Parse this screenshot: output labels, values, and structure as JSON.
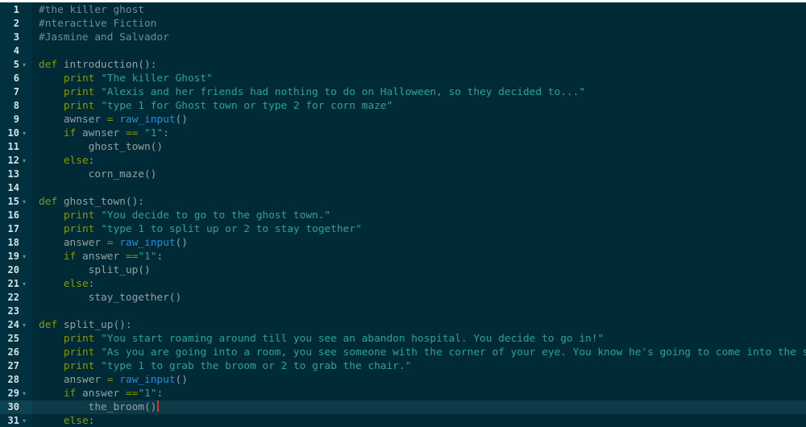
{
  "colors": {
    "background": "#002b36",
    "gutter": "#01313f",
    "active_line": "#0d3a47",
    "comment": "#6f8c95",
    "keyword": "#859900",
    "string": "#2aa198",
    "builtin": "#268bd2",
    "plain": "#93a1a1",
    "line_number": "#d7e2e2",
    "cursor": "#dc322f"
  },
  "editor": {
    "active_line": 30,
    "cursor_after": "()",
    "lines": [
      {
        "n": 1,
        "fold": false,
        "tokens": [
          {
            "t": "#the killer ghost",
            "k": "comment"
          }
        ]
      },
      {
        "n": 2,
        "fold": false,
        "tokens": [
          {
            "t": "#nteractive Fiction",
            "k": "comment"
          }
        ]
      },
      {
        "n": 3,
        "fold": false,
        "tokens": [
          {
            "t": "#Jasmine and Salvador",
            "k": "comment"
          }
        ]
      },
      {
        "n": 4,
        "fold": false,
        "tokens": []
      },
      {
        "n": 5,
        "fold": true,
        "tokens": [
          {
            "t": "def",
            "k": "keyword"
          },
          {
            "t": " introduction():",
            "k": "plain"
          }
        ]
      },
      {
        "n": 6,
        "fold": false,
        "tokens": [
          {
            "t": "    ",
            "k": "plain"
          },
          {
            "t": "print",
            "k": "keyword"
          },
          {
            "t": " ",
            "k": "plain"
          },
          {
            "t": "\"The killer Ghost\"",
            "k": "string"
          }
        ]
      },
      {
        "n": 7,
        "fold": false,
        "tokens": [
          {
            "t": "    ",
            "k": "plain"
          },
          {
            "t": "print",
            "k": "keyword"
          },
          {
            "t": " ",
            "k": "plain"
          },
          {
            "t": "\"Alexis and her friends had nothing to do on Halloween, so they decided to...\"",
            "k": "string"
          }
        ]
      },
      {
        "n": 8,
        "fold": false,
        "tokens": [
          {
            "t": "    ",
            "k": "plain"
          },
          {
            "t": "print",
            "k": "keyword"
          },
          {
            "t": " ",
            "k": "plain"
          },
          {
            "t": "\"type 1 for Ghost town or type 2 for corn maze\"",
            "k": "string"
          }
        ]
      },
      {
        "n": 9,
        "fold": false,
        "tokens": [
          {
            "t": "    awnser ",
            "k": "plain"
          },
          {
            "t": "=",
            "k": "keyword"
          },
          {
            "t": " ",
            "k": "plain"
          },
          {
            "t": "raw_input",
            "k": "builtin"
          },
          {
            "t": "()",
            "k": "plain"
          }
        ]
      },
      {
        "n": 10,
        "fold": true,
        "tokens": [
          {
            "t": "    ",
            "k": "plain"
          },
          {
            "t": "if",
            "k": "keyword"
          },
          {
            "t": " awnser ",
            "k": "plain"
          },
          {
            "t": "==",
            "k": "keyword"
          },
          {
            "t": " ",
            "k": "plain"
          },
          {
            "t": "\"1\"",
            "k": "string"
          },
          {
            "t": ":",
            "k": "plain"
          }
        ]
      },
      {
        "n": 11,
        "fold": false,
        "tokens": [
          {
            "t": "        ghost_town()",
            "k": "plain"
          }
        ]
      },
      {
        "n": 12,
        "fold": true,
        "tokens": [
          {
            "t": "    ",
            "k": "plain"
          },
          {
            "t": "else",
            "k": "keyword"
          },
          {
            "t": ":",
            "k": "plain"
          }
        ]
      },
      {
        "n": 13,
        "fold": false,
        "tokens": [
          {
            "t": "        corn_maze()",
            "k": "plain"
          }
        ]
      },
      {
        "n": 14,
        "fold": false,
        "tokens": []
      },
      {
        "n": 15,
        "fold": true,
        "tokens": [
          {
            "t": "def",
            "k": "keyword"
          },
          {
            "t": " ghost_town():",
            "k": "plain"
          }
        ]
      },
      {
        "n": 16,
        "fold": false,
        "tokens": [
          {
            "t": "    ",
            "k": "plain"
          },
          {
            "t": "print",
            "k": "keyword"
          },
          {
            "t": " ",
            "k": "plain"
          },
          {
            "t": "\"You decide to go to the ghost town.\"",
            "k": "string"
          }
        ]
      },
      {
        "n": 17,
        "fold": false,
        "tokens": [
          {
            "t": "    ",
            "k": "plain"
          },
          {
            "t": "print",
            "k": "keyword"
          },
          {
            "t": " ",
            "k": "plain"
          },
          {
            "t": "\"type 1 to split up or 2 to stay together\"",
            "k": "string"
          }
        ]
      },
      {
        "n": 18,
        "fold": false,
        "tokens": [
          {
            "t": "    answer ",
            "k": "plain"
          },
          {
            "t": "=",
            "k": "keyword"
          },
          {
            "t": " ",
            "k": "plain"
          },
          {
            "t": "raw_input",
            "k": "builtin"
          },
          {
            "t": "()",
            "k": "plain"
          }
        ]
      },
      {
        "n": 19,
        "fold": true,
        "tokens": [
          {
            "t": "    ",
            "k": "plain"
          },
          {
            "t": "if",
            "k": "keyword"
          },
          {
            "t": " answer ",
            "k": "plain"
          },
          {
            "t": "==",
            "k": "keyword"
          },
          {
            "t": "\"1\"",
            "k": "string"
          },
          {
            "t": ":",
            "k": "plain"
          }
        ]
      },
      {
        "n": 20,
        "fold": false,
        "tokens": [
          {
            "t": "        split_up()",
            "k": "plain"
          }
        ]
      },
      {
        "n": 21,
        "fold": true,
        "tokens": [
          {
            "t": "    ",
            "k": "plain"
          },
          {
            "t": "else",
            "k": "keyword"
          },
          {
            "t": ":",
            "k": "plain"
          }
        ]
      },
      {
        "n": 22,
        "fold": false,
        "tokens": [
          {
            "t": "        stay_together()",
            "k": "plain"
          }
        ]
      },
      {
        "n": 23,
        "fold": false,
        "tokens": []
      },
      {
        "n": 24,
        "fold": true,
        "tokens": [
          {
            "t": "def",
            "k": "keyword"
          },
          {
            "t": " split_up():",
            "k": "plain"
          }
        ]
      },
      {
        "n": 25,
        "fold": false,
        "tokens": [
          {
            "t": "    ",
            "k": "plain"
          },
          {
            "t": "print",
            "k": "keyword"
          },
          {
            "t": " ",
            "k": "plain"
          },
          {
            "t": "\"You start roaming around till you see an abandon hospital. You decide to go in!\"",
            "k": "string"
          }
        ]
      },
      {
        "n": 26,
        "fold": false,
        "tokens": [
          {
            "t": "    ",
            "k": "plain"
          },
          {
            "t": "print",
            "k": "keyword"
          },
          {
            "t": " ",
            "k": "plain"
          },
          {
            "t": "\"As you are going into a room, you see someone with the corner of your eye. You know he's going to come into the s",
            "k": "string"
          }
        ]
      },
      {
        "n": 27,
        "fold": false,
        "tokens": [
          {
            "t": "    ",
            "k": "plain"
          },
          {
            "t": "print",
            "k": "keyword"
          },
          {
            "t": " ",
            "k": "plain"
          },
          {
            "t": "\"type 1 to grab the broom or 2 to grab the chair.\"",
            "k": "string"
          }
        ]
      },
      {
        "n": 28,
        "fold": false,
        "tokens": [
          {
            "t": "    answer ",
            "k": "plain"
          },
          {
            "t": "=",
            "k": "keyword"
          },
          {
            "t": " ",
            "k": "plain"
          },
          {
            "t": "raw_input",
            "k": "builtin"
          },
          {
            "t": "()",
            "k": "plain"
          }
        ]
      },
      {
        "n": 29,
        "fold": true,
        "tokens": [
          {
            "t": "    ",
            "k": "plain"
          },
          {
            "t": "if",
            "k": "keyword"
          },
          {
            "t": " answer ",
            "k": "plain"
          },
          {
            "t": "==",
            "k": "keyword"
          },
          {
            "t": "\"1\"",
            "k": "string"
          },
          {
            "t": ":",
            "k": "plain"
          }
        ]
      },
      {
        "n": 30,
        "fold": false,
        "tokens": [
          {
            "t": "        the_broom()",
            "k": "plain"
          }
        ]
      },
      {
        "n": 31,
        "fold": true,
        "tokens": [
          {
            "t": "    ",
            "k": "plain"
          },
          {
            "t": "else",
            "k": "keyword"
          },
          {
            "t": ":",
            "k": "plain"
          }
        ]
      }
    ]
  }
}
